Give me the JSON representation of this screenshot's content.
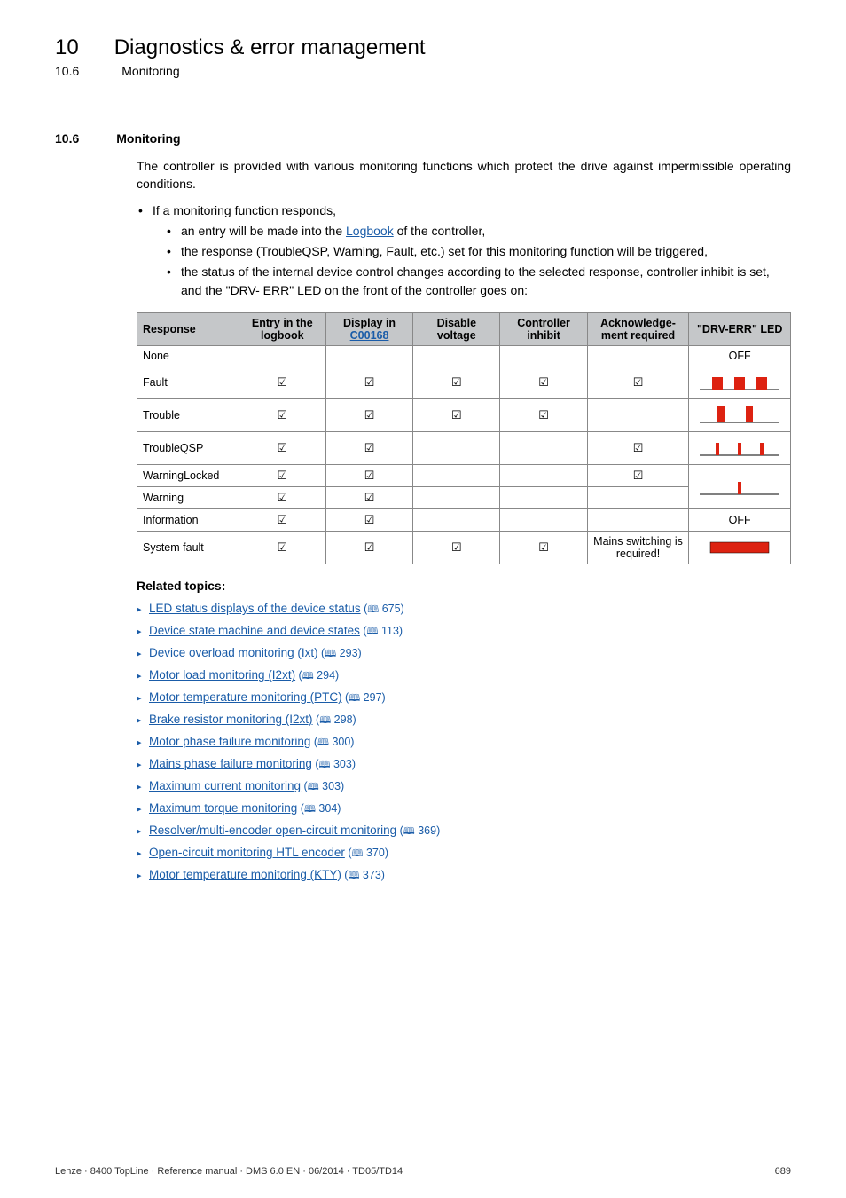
{
  "header": {
    "chapter_number": "10",
    "chapter_title": "Diagnostics & error management",
    "subsection_number": "10.6",
    "subsection_title": "Monitoring"
  },
  "section": {
    "number": "10.6",
    "title": "Monitoring",
    "intro": "The controller is provided with various monitoring functions which protect the drive against impermissible operating conditions.",
    "bullet_main": "If a monitoring function responds,",
    "sub_bullets": {
      "b1_pre": "an entry will be made into the ",
      "b1_link": "Logbook",
      "b1_post": " of the controller,",
      "b2": "the response (TroubleQSP, Warning, Fault, etc.) set for this monitoring function will be triggered,",
      "b3": "the status of the internal device control changes according to the selected response, controller inhibit is set, and the \"DRV- ERR\" LED on the front of the controller goes on:"
    }
  },
  "table": {
    "headers": {
      "c0": "Response",
      "c1": "Entry in the logbook",
      "c2_line1": "Display in",
      "c2_link": "C00168",
      "c3": "Disable voltage",
      "c4": "Controller inhibit",
      "c5": "Acknowledge­ment required",
      "c6": "\"DRV-ERR\" LED"
    },
    "rows": [
      {
        "response": "None",
        "log": "",
        "disp": "",
        "disable": "",
        "inhibit": "",
        "ack": "",
        "led_type": "off"
      },
      {
        "response": "Fault",
        "log": "☑",
        "disp": "☑",
        "disable": "☑",
        "inhibit": "☑",
        "ack": "☑",
        "led_type": "red3"
      },
      {
        "response": "Trouble",
        "log": "☑",
        "disp": "☑",
        "disable": "☑",
        "inhibit": "☑",
        "ack": "",
        "led_type": "red2long"
      },
      {
        "response": "TroubleQSP",
        "log": "☑",
        "disp": "☑",
        "disable": "",
        "inhibit": "",
        "ack": "☑",
        "led_type": "red3thin"
      },
      {
        "response": "WarningLocked",
        "log": "☑",
        "disp": "☑",
        "disable": "",
        "inhibit": "",
        "ack": "☑",
        "led_type": "red1thin_span",
        "rowspan_led": 2
      },
      {
        "response": "Warning",
        "log": "☑",
        "disp": "☑",
        "disable": "",
        "inhibit": "",
        "ack": "",
        "led_type": "skip"
      },
      {
        "response": "Information",
        "log": "☑",
        "disp": "☑",
        "disable": "",
        "inhibit": "",
        "ack": "",
        "led_type": "off"
      },
      {
        "response": "System fault",
        "log": "☑",
        "disp": "☑",
        "disable": "☑",
        "inhibit": "☑",
        "ack_text": "Mains switching is required!",
        "led_type": "redsolid"
      }
    ],
    "off_label": "OFF"
  },
  "related": {
    "title": "Related topics:",
    "items": [
      {
        "text": "LED status displays of the device status",
        "page": "675"
      },
      {
        "text": "Device state machine and device states",
        "page": "113",
        "space_before_paren": true
      },
      {
        "text": "Device overload monitoring (Ixt)",
        "page": "293"
      },
      {
        "text": "Motor load monitoring (I2xt)",
        "page": "294"
      },
      {
        "text": "Motor temperature monitoring (PTC)",
        "page": "297"
      },
      {
        "text": "Brake resistor monitoring (I2xt)",
        "page": "298"
      },
      {
        "text": "Motor phase failure monitoring",
        "page": "300"
      },
      {
        "text": "Mains phase failure monitoring",
        "page": "303"
      },
      {
        "text": "Maximum current monitoring",
        "page": "303"
      },
      {
        "text": "Maximum torque monitoring",
        "page": "304"
      },
      {
        "text": "Resolver/multi-encoder open-circuit monitoring",
        "page": "369"
      },
      {
        "text": "Open-circuit monitoring HTL encoder",
        "page": "370"
      },
      {
        "text": "Motor temperature monitoring (KTY)",
        "page": "373"
      }
    ]
  },
  "footer": {
    "left": "Lenze · 8400 TopLine · Reference manual · DMS 6.0 EN · 06/2014 · TD05/TD14",
    "right": "689"
  }
}
